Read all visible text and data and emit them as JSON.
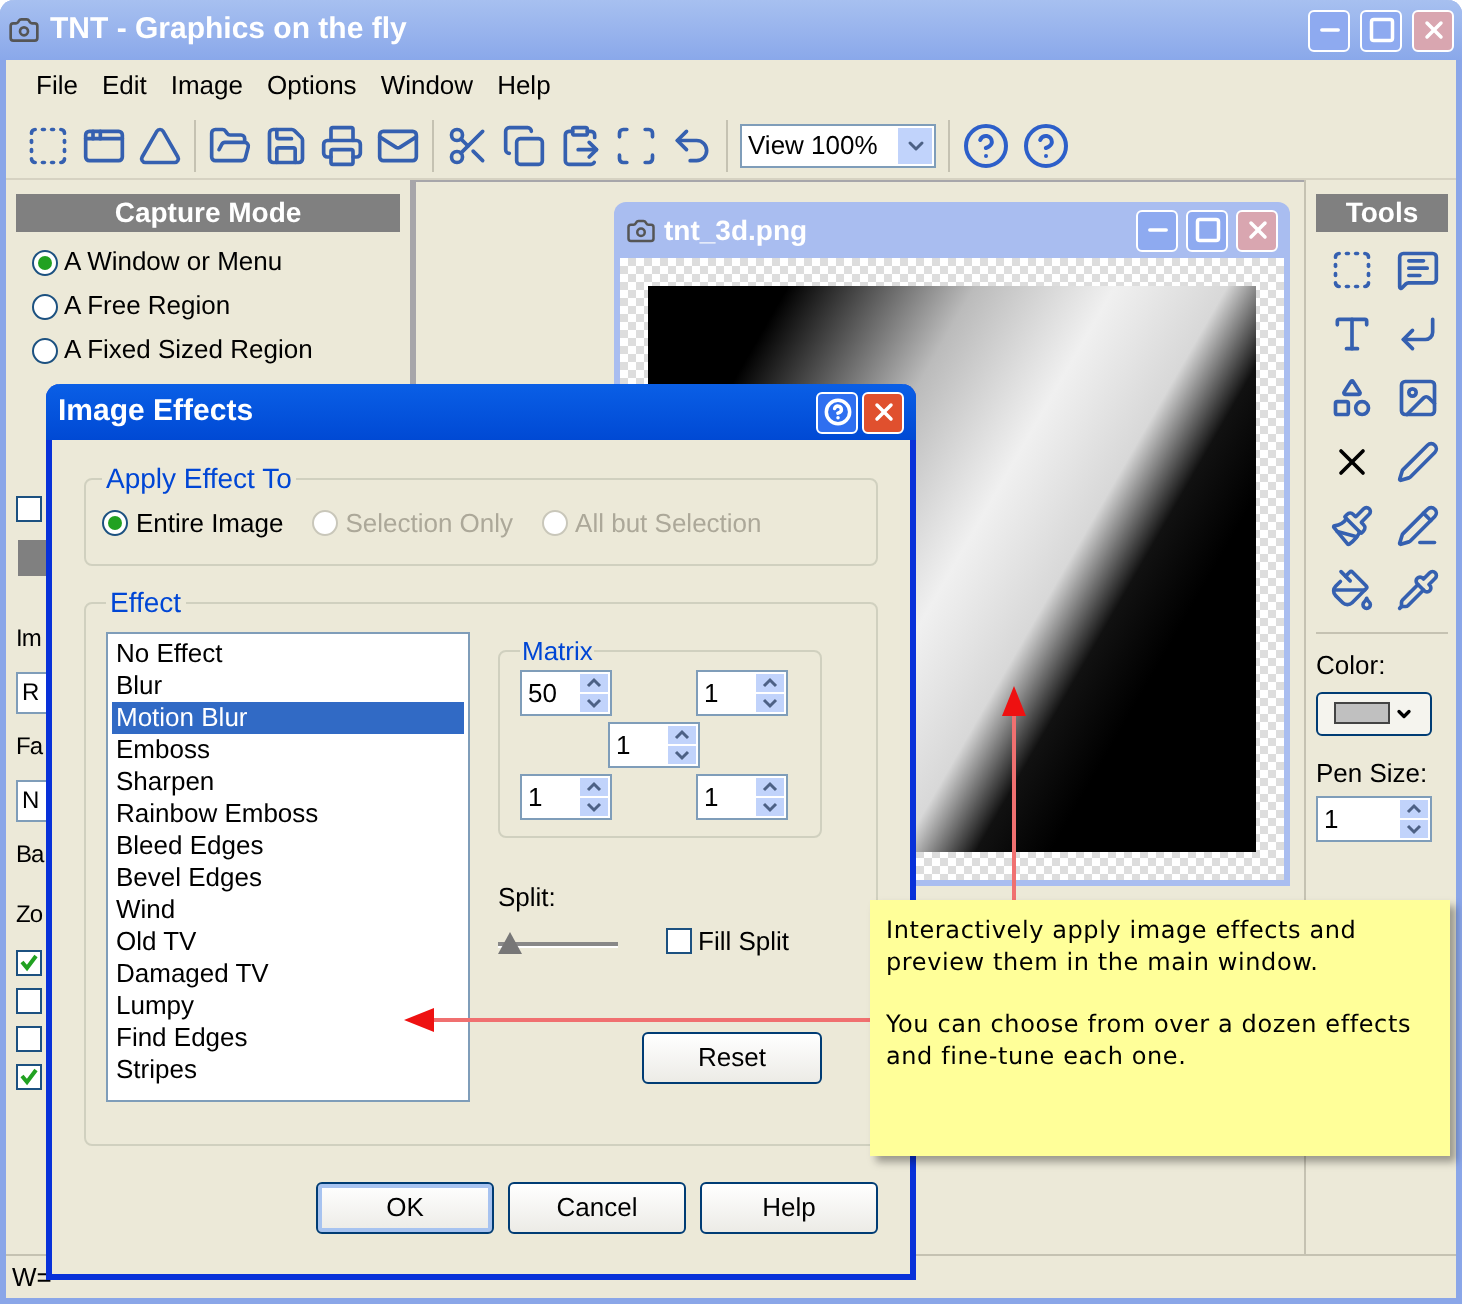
{
  "window": {
    "title": "TNT - Graphics on the fly"
  },
  "menu": [
    {
      "label": "File"
    },
    {
      "label": "Edit"
    },
    {
      "label": "Image"
    },
    {
      "label": "Options"
    },
    {
      "label": "Window"
    },
    {
      "label": "Help"
    }
  ],
  "toolbar": {
    "zoom_select": {
      "value": "View 100%"
    }
  },
  "capture_panel": {
    "title": "Capture Mode",
    "modes": [
      {
        "label": "A Window or Menu",
        "selected": true
      },
      {
        "label": "A Free Region",
        "selected": false
      },
      {
        "label": "A Fixed Sized Region",
        "selected": false
      }
    ],
    "items": [
      {
        "kind": "checkbox",
        "checked": false
      },
      {
        "kind": "header"
      },
      {
        "kind": "label",
        "text": "Im"
      },
      {
        "kind": "field",
        "value": "R"
      },
      {
        "kind": "label",
        "text": "Fa"
      },
      {
        "kind": "field",
        "value": "N"
      },
      {
        "kind": "label",
        "text": "Ba"
      },
      {
        "kind": "label",
        "text": "Zo"
      },
      {
        "kind": "checkbox",
        "checked": true
      },
      {
        "kind": "checkbox",
        "checked": false
      },
      {
        "kind": "checkbox",
        "checked": false
      },
      {
        "kind": "checkbox",
        "checked": true
      }
    ]
  },
  "image_window": {
    "title": "tnt_3d.png"
  },
  "tools_panel": {
    "title": "Tools",
    "color_label": "Color:",
    "pen_size_label": "Pen Size:",
    "pen_size": "1"
  },
  "dialog": {
    "title": "Image Effects",
    "apply_group": {
      "title": "Apply Effect To",
      "options": [
        {
          "label": "Entire Image",
          "selected": true,
          "disabled": false
        },
        {
          "label": "Selection Only",
          "selected": false,
          "disabled": true
        },
        {
          "label": "All but Selection",
          "selected": false,
          "disabled": true
        }
      ]
    },
    "effect_group": {
      "title": "Effect",
      "effects": [
        {
          "label": "No Effect",
          "selected": false
        },
        {
          "label": "Blur",
          "selected": false
        },
        {
          "label": "Motion Blur",
          "selected": true
        },
        {
          "label": "Emboss",
          "selected": false
        },
        {
          "label": "Sharpen",
          "selected": false
        },
        {
          "label": "Rainbow Emboss",
          "selected": false
        },
        {
          "label": "Bleed Edges",
          "selected": false
        },
        {
          "label": "Bevel Edges",
          "selected": false
        },
        {
          "label": "Wind",
          "selected": false
        },
        {
          "label": "Old TV",
          "selected": false
        },
        {
          "label": "Damaged TV",
          "selected": false
        },
        {
          "label": "Lumpy",
          "selected": false
        },
        {
          "label": "Find Edges",
          "selected": false
        },
        {
          "label": "Stripes",
          "selected": false
        }
      ],
      "matrix": {
        "title": "Matrix",
        "cells": [
          "50",
          "1",
          "1",
          "1",
          "1"
        ]
      },
      "split": {
        "label": "Split:",
        "level": 0.05
      },
      "fill_split": {
        "label": "Fill Split",
        "checked": false
      },
      "reset": "Reset"
    },
    "buttons": [
      {
        "label": "OK",
        "default": true
      },
      {
        "label": "Cancel",
        "default": false
      },
      {
        "label": "Help",
        "default": false
      }
    ]
  },
  "callout": {
    "paragraphs": [
      "Interactively apply image effects and preview them in the main window.",
      "You can choose from over a dozen effects and fine-tune each one."
    ]
  },
  "status_bar": {
    "text": "W="
  }
}
